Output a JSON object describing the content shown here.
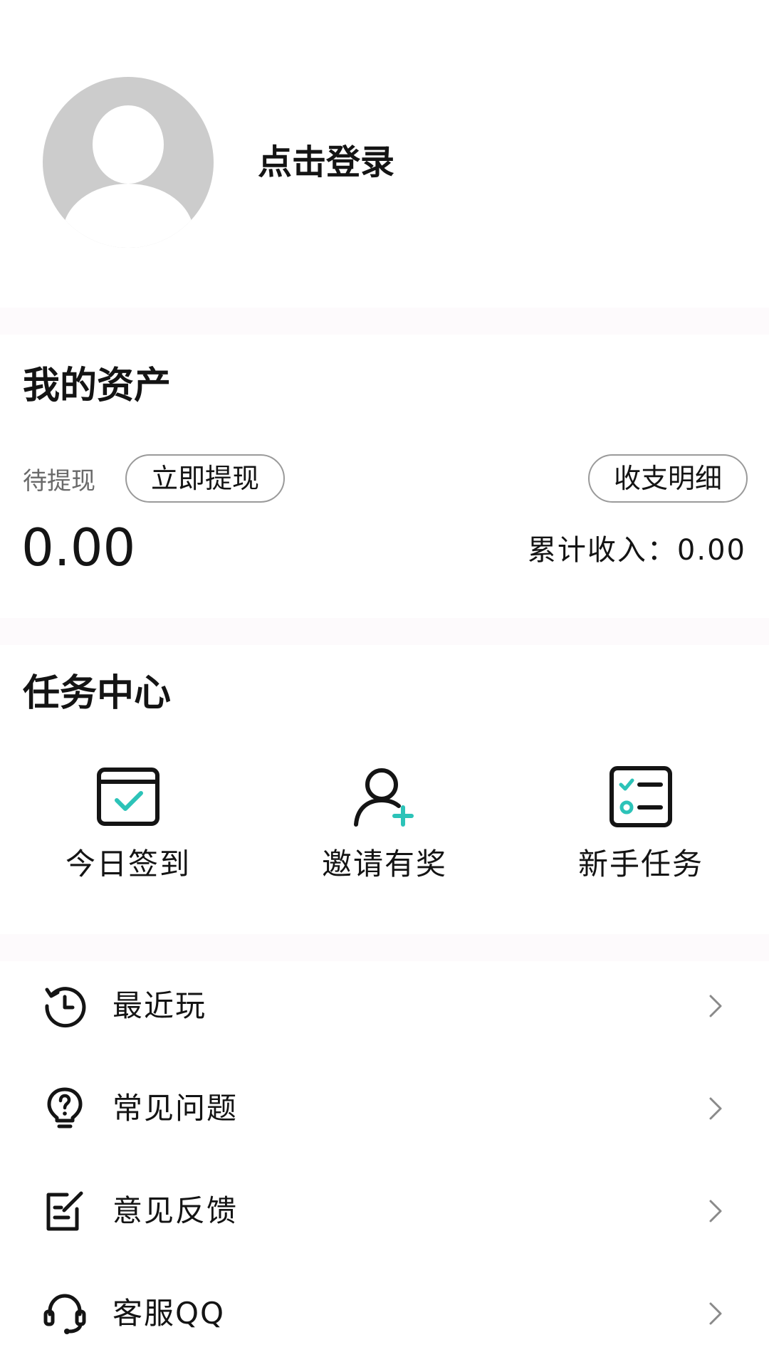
{
  "profile": {
    "login_text": "点击登录"
  },
  "assets": {
    "title": "我的资产",
    "pending_label": "待提现",
    "withdraw_button": "立即提现",
    "details_button": "收支明细",
    "balance": "0.00",
    "total_income": "累计收入：0.00"
  },
  "tasks": {
    "title": "任务中心",
    "items": [
      {
        "label": "今日签到",
        "icon": "calendar-check-icon"
      },
      {
        "label": "邀请有奖",
        "icon": "user-plus-icon"
      },
      {
        "label": "新手任务",
        "icon": "checklist-icon"
      }
    ]
  },
  "menu": {
    "items": [
      {
        "label": "最近玩",
        "icon": "history-icon"
      },
      {
        "label": "常见问题",
        "icon": "help-bulb-icon"
      },
      {
        "label": "意见反馈",
        "icon": "edit-note-icon"
      },
      {
        "label": "客服QQ",
        "icon": "headset-icon"
      }
    ]
  },
  "colors": {
    "accent": "#2cc3b8",
    "text": "#141414",
    "muted": "#6a6a6a",
    "avatar": "#cccccc"
  }
}
